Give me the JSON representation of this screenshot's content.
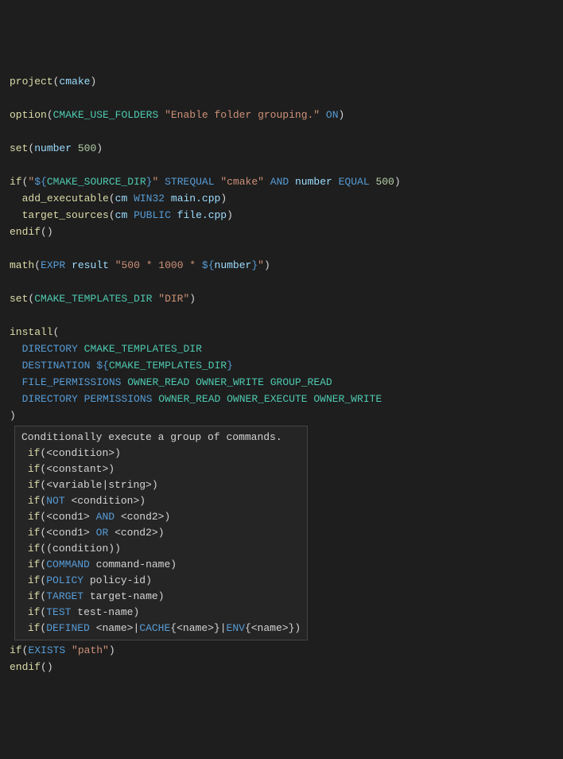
{
  "code": {
    "l1": {
      "fn": "project",
      "arg": "cmake"
    },
    "l3": {
      "fn": "option",
      "var": "CMAKE_USE_FOLDERS",
      "str": "\"Enable folder grouping.\"",
      "kw": "ON"
    },
    "l5": {
      "fn": "set",
      "var": "number",
      "num": "500"
    },
    "l7": {
      "fn": "if",
      "sp1": "\"",
      "sp2": "${",
      "var1": "CMAKE_SOURCE_DIR",
      "sp3": "}",
      "sp4": "\"",
      "kw1": "STREQUAL",
      "str": "\"cmake\"",
      "kw2": "AND",
      "var2": "number",
      "kw3": "EQUAL",
      "num": "500"
    },
    "l8": {
      "fn": "add_executable",
      "var": "cm",
      "kw": "WIN32",
      "file": "main.cpp"
    },
    "l9": {
      "fn": "target_sources",
      "var": "cm",
      "kw": "PUBLIC",
      "file": "file.cpp"
    },
    "l10": {
      "fn": "endif"
    },
    "l12": {
      "fn": "math",
      "kw": "EXPR",
      "var": "result",
      "s1": "\"500 * 1000 * ",
      "s2": "${",
      "s3": "number",
      "s4": "}",
      "s5": "\""
    },
    "l14": {
      "fn": "set",
      "var": "CMAKE_TEMPLATES_DIR",
      "str": "\"DIR\""
    },
    "l16": {
      "fn": "install"
    },
    "l17": {
      "kw": "DIRECTORY",
      "var": "CMAKE_TEMPLATES_DIR"
    },
    "l18": {
      "kw": "DESTINATION",
      "p1": "${",
      "var": "CMAKE_TEMPLATES_DIR",
      "p2": "}"
    },
    "l19": {
      "kw": "FILE_PERMISSIONS",
      "c1": "OWNER_READ",
      "c2": "OWNER_WRITE",
      "c3": "GROUP_READ"
    },
    "l20": {
      "kw1": "DIRECTORY",
      "kw2": "PERMISSIONS",
      "c1": "OWNER_READ",
      "c2": "OWNER_EXECUTE",
      "c3": "OWNER_WRITE"
    },
    "l34": {
      "fn": "if",
      "kw": "EXISTS",
      "str": "\"path\""
    },
    "l35": {
      "fn": "endif"
    }
  },
  "tooltip": {
    "title": "Conditionally execute a group of commands.",
    "r1": {
      "fn": "if",
      "a": "<condition>"
    },
    "r2": {
      "fn": "if",
      "a": "<constant>"
    },
    "r3": {
      "fn": "if",
      "a": "<variable|string>"
    },
    "r4": {
      "fn": "if",
      "kw": "NOT",
      "a": "<condition>"
    },
    "r5": {
      "fn": "if",
      "a1": "<cond1>",
      "kw": "AND",
      "a2": "<cond2>"
    },
    "r6": {
      "fn": "if",
      "a1": "<cond1>",
      "kw": "OR",
      "a2": "<cond2>"
    },
    "r7": {
      "fn": "if",
      "a": "(condition)"
    },
    "r8": {
      "fn": "if",
      "kw": "COMMAND",
      "a": "command-name"
    },
    "r9": {
      "fn": "if",
      "kw": "POLICY",
      "a": "policy-id"
    },
    "r10": {
      "fn": "if",
      "kw": "TARGET",
      "a": "target-name"
    },
    "r11": {
      "fn": "if",
      "kw": "TEST",
      "a": "test-name"
    },
    "r12": {
      "fn": "if",
      "kw1": "DEFINED",
      "a1": "<name>",
      "kw2": "CACHE",
      "a2": "<name>",
      "kw3": "ENV",
      "a3": "<name>"
    }
  }
}
